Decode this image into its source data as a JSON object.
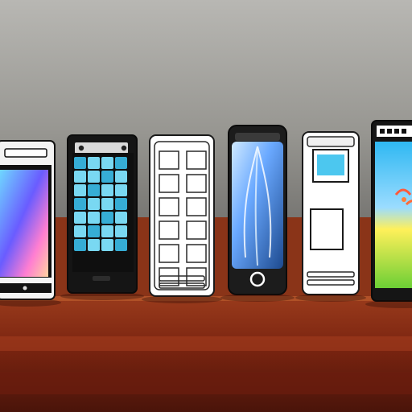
{
  "scene": {
    "description_free": true,
    "wall_colors": [
      "#b3b2ae",
      "#8e8d89",
      "#6f6e6b"
    ],
    "shelf_colors": [
      "#a8421f",
      "#7a2410",
      "#4a140a"
    ],
    "devices": [
      {
        "name": "phone-gradient-screen",
        "screen": "gradient",
        "palette": [
          "#6fd7ff",
          "#6a5cff",
          "#ff7ed1",
          "#ffd3a0"
        ]
      },
      {
        "name": "phone-grid-screen",
        "screen": "grid",
        "palette": [
          "#1a1a1a",
          "#7fe4ff",
          "#39b6e0"
        ]
      },
      {
        "name": "phone-outline-sketch",
        "screen": "outline-grid",
        "palette": [
          "#ffffff",
          "#e8e8e8",
          "#2a2a2a"
        ]
      },
      {
        "name": "phone-leaf-screen",
        "screen": "leaf",
        "palette": [
          "#1e1e1e",
          "#3b7bd8",
          "#9bd0ff"
        ]
      },
      {
        "name": "phone-white-sketch",
        "screen": "two-panels",
        "palette": [
          "#ffffff",
          "#4cc7ef",
          "#2a2a2a"
        ]
      },
      {
        "name": "phone-landscape-screen",
        "screen": "landscape",
        "palette": [
          "#3bd0ff",
          "#ffe15a",
          "#83d43a"
        ]
      }
    ]
  }
}
